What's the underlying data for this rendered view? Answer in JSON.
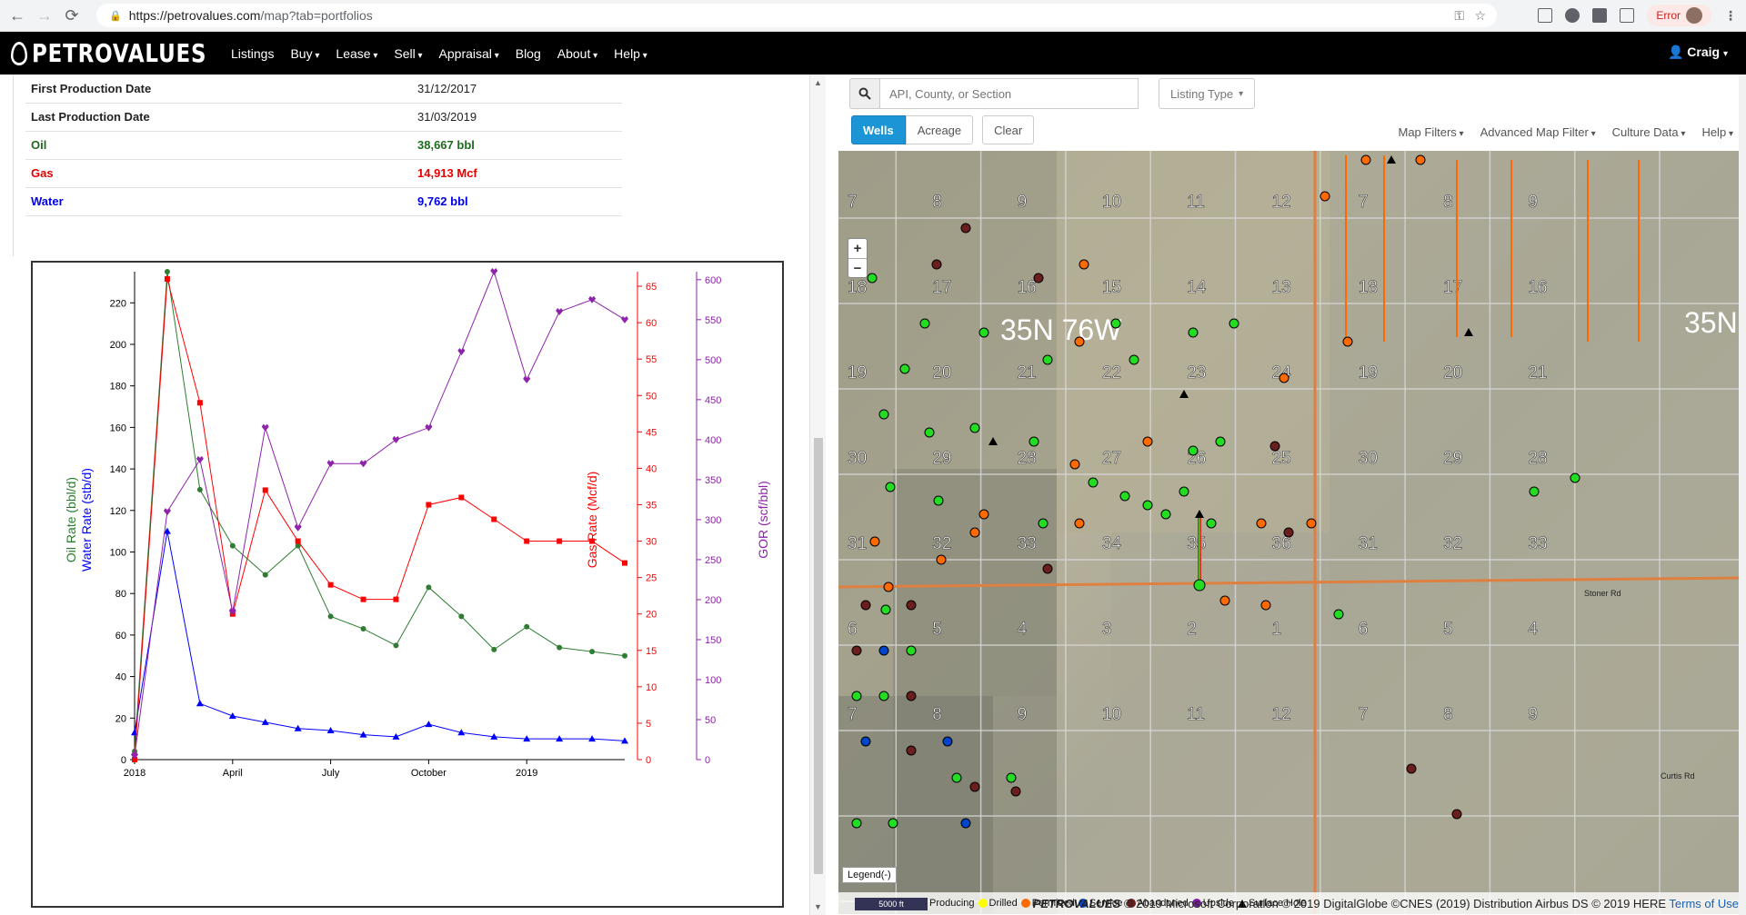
{
  "browser": {
    "url_host": "https://petrovalues.com",
    "url_path": "/map?tab=portfolios",
    "error_label": "Error"
  },
  "nav": {
    "brand": "PETROVALUES",
    "items": [
      "Listings",
      "Buy",
      "Lease",
      "Sell",
      "Appraisal",
      "Blog",
      "About",
      "Help"
    ],
    "user": "Craig"
  },
  "production": [
    {
      "label": "First Production Date",
      "value": "31/12/2017"
    },
    {
      "label": "Last Production Date",
      "value": "31/03/2019"
    },
    {
      "label": "Oil",
      "value": "38,667 bbl"
    },
    {
      "label": "Gas",
      "value": "14,913 Mcf"
    },
    {
      "label": "Water",
      "value": "9,762 bbl"
    }
  ],
  "colors": {
    "oil": "#2e7d32",
    "gas": "#ff0000",
    "water": "#0000ff",
    "gor": "#8e24aa"
  },
  "chart_data": {
    "type": "line",
    "x": [
      "2017-12-31",
      "2018-01-31",
      "2018-02-28",
      "2018-03-31",
      "2018-04-30",
      "2018-05-31",
      "2018-06-30",
      "2018-07-31",
      "2018-08-31",
      "2018-09-30",
      "2018-10-31",
      "2018-11-30",
      "2018-12-31",
      "2019-01-31",
      "2019-02-28",
      "2019-03-31"
    ],
    "x_tick_labels": [
      "2018",
      "April",
      "July",
      "October",
      "2019"
    ],
    "series": [
      {
        "axis": "oil",
        "values": [
          4,
          235,
          130,
          103,
          89,
          103,
          69,
          63,
          55,
          83,
          69,
          53,
          64,
          54,
          52,
          50
        ]
      },
      {
        "axis": "water",
        "values": [
          13,
          110,
          27,
          21,
          18,
          15,
          14,
          12,
          11,
          17,
          13,
          11,
          10,
          10,
          10,
          9
        ]
      },
      {
        "axis": "gas",
        "values": [
          0,
          66,
          49,
          20,
          37,
          30,
          24,
          22,
          22,
          35,
          36,
          33,
          30,
          30,
          30,
          27
        ]
      },
      {
        "axis": "gor",
        "values": [
          5,
          310,
          375,
          185,
          415,
          290,
          370,
          370,
          400,
          415,
          510,
          610,
          475,
          560,
          575,
          550
        ]
      }
    ],
    "axes": {
      "left_oil_water": {
        "label_oil": "Oil Rate (bbl/d)",
        "label_water": "Water Rate (stb/d)",
        "range": [
          0,
          235
        ],
        "ticks": [
          0,
          20,
          40,
          60,
          80,
          100,
          120,
          140,
          160,
          180,
          200,
          220
        ]
      },
      "gas": {
        "label": "Gas Rate (Mcf/d)",
        "range": [
          0,
          67
        ],
        "ticks": [
          0,
          5,
          10,
          15,
          20,
          25,
          30,
          35,
          40,
          45,
          50,
          55,
          60,
          65
        ]
      },
      "gor": {
        "label": "GOR (scf/bbl)",
        "range": [
          0,
          610
        ],
        "ticks": [
          0,
          50,
          100,
          150,
          200,
          250,
          300,
          350,
          400,
          450,
          500,
          550,
          600
        ]
      }
    }
  },
  "map": {
    "search_placeholder": "API, County, or Section",
    "listing_type": "Listing Type",
    "tabs": [
      "Wells",
      "Acreage"
    ],
    "clear": "Clear",
    "menus": [
      "Map Filters",
      "Advanced Map Filter",
      "Culture Data",
      "Help"
    ],
    "township_label": "35N 76W",
    "township_label_2": "35N",
    "legend_toggle": "Legend(-)",
    "legend": [
      {
        "label": "Producing",
        "color": "#22dd22"
      },
      {
        "label": "Drilled",
        "color": "#ffff00"
      },
      {
        "label": "Permitted",
        "color": "#ff6a00"
      },
      {
        "label": "Service",
        "color": "#0044cc"
      },
      {
        "label": "Abandoned",
        "color": "#6b1e1e"
      },
      {
        "label": "Upside",
        "color": "#7a1fa2"
      },
      {
        "label": "Surface Hole",
        "color": "#000000"
      }
    ],
    "scale": "5000 ft",
    "copyright_brand": "PETROVALUES",
    "copyright_text": "© 2019 Microsoft Corporation © 2019 DigitalGlobe ©CNES (2019) Distribution Airbus DS © 2019 HERE",
    "terms": "Terms of Use",
    "roads": [
      "Stoner Rd",
      "Curtis Rd"
    ],
    "sections": [
      [
        "7",
        "8",
        "9",
        "10",
        "11",
        "12",
        "7",
        "8",
        "9"
      ],
      [
        "18",
        "17",
        "16",
        "15",
        "14",
        "13",
        "18",
        "17",
        "16"
      ],
      [
        "19",
        "20",
        "21",
        "22",
        "23",
        "24",
        "19",
        "20",
        "21"
      ],
      [
        "30",
        "29",
        "28",
        "27",
        "26",
        "25",
        "30",
        "29",
        "28"
      ],
      [
        "31",
        "32",
        "33",
        "34",
        "35",
        "36",
        "31",
        "32",
        "33"
      ],
      [
        "6",
        "5",
        "4",
        "3",
        "2",
        "1",
        "6",
        "5",
        "4"
      ],
      [
        "7",
        "8",
        "9",
        "10",
        "11",
        "12",
        "7",
        "8",
        "9"
      ]
    ]
  }
}
